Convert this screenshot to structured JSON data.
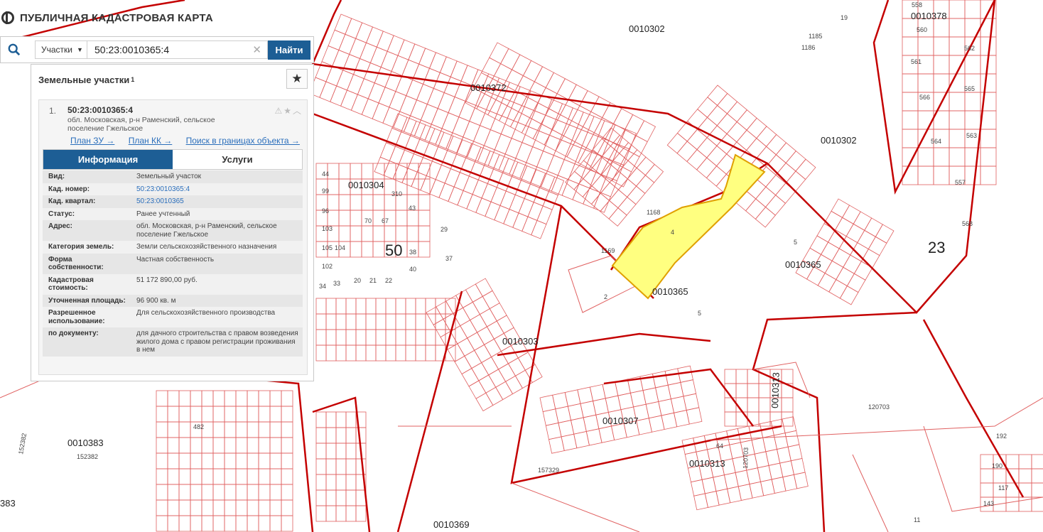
{
  "app": {
    "title": "ПУБЛИЧНАЯ КАДАСТРОВАЯ КАРТА"
  },
  "search": {
    "type_label": "Участки",
    "query": "50:23:0010365:4",
    "button_label": "Найти"
  },
  "panel": {
    "title": "Земельные участки",
    "count": "1",
    "result": {
      "index": "1.",
      "cadastral_number": "50:23:0010365:4",
      "address": "обл. Московская, р-н Раменский, сельское поселение Гжельское",
      "links": [
        "План ЗУ →",
        "План КК →",
        "Поиск в границах объекта →"
      ],
      "tabs": [
        "Информация",
        "Услуги"
      ],
      "attributes": [
        {
          "key": "Вид:",
          "value": "Земельный участок"
        },
        {
          "key": "Кад. номер:",
          "value": "50:23:0010365:4"
        },
        {
          "key": "Кад. квартал:",
          "value": "50:23:0010365"
        },
        {
          "key": "Статус:",
          "value": "Ранее учтенный"
        },
        {
          "key": "Адрес:",
          "value": "обл. Московская, р-н Раменский, сельское поселение Гжельское"
        },
        {
          "key": "Категория земель:",
          "value": "Земли сельскохозяйственного назначения"
        },
        {
          "key": "Форма собственности:",
          "value": "Частная собственность"
        },
        {
          "key": "Кадастровая стоимость:",
          "value": "51 172 890,00 руб."
        },
        {
          "key": "Уточненная площадь:",
          "value": "96 900 кв. м"
        },
        {
          "key": "Разрешенное использование:",
          "value": "Для сельскохозяйственного производства"
        },
        {
          "key": "по документу:",
          "value": "для дачного строительства с правом возведения жилого дома с правом регистрации проживания в нем"
        }
      ]
    }
  },
  "map": {
    "labels": {
      "q0010302a": "0010302",
      "q0010372": "0010372",
      "q0010302b": "0010302",
      "q0010304": "0010304",
      "q0010365a": "0010365",
      "q0010365b": "0010365",
      "q0010303": "0010303",
      "q0010307": "0010307",
      "q0010383": "0010383",
      "q152382": "152382",
      "q152382b": "152382",
      "q0010313a": "0010313",
      "q0010313b": "0010313",
      "q0010369": "0010369",
      "q120703": "120703",
      "q157329": "157329",
      "q0010378": "0010378",
      "num50": "50",
      "num23": "23",
      "num4": "4",
      "num2": "2",
      "num5a": "5",
      "num5b": "5",
      "n1168": "1168",
      "n1169": "1169",
      "n560": "560",
      "n561": "561",
      "n562": "562",
      "n565": "565",
      "n566": "566",
      "n563": "563",
      "n564": "564",
      "n557": "557",
      "n568": "568",
      "n558": "558",
      "n1185": "1185",
      "n1186": "1186",
      "n19": "19",
      "n192": "192",
      "n190": "190",
      "n383": "383",
      "n11": "11",
      "n120703b": "120703",
      "n64": "64",
      "n310": "310",
      "n44": "44",
      "n99": "99",
      "n96": "96",
      "n103": "103",
      "n105": "105",
      "n102": "102",
      "n104": "104",
      "n70": "70",
      "n67": "67",
      "n43": "43",
      "n38": "38",
      "n40": "40",
      "n37": "37",
      "n34": "34",
      "n33": "33",
      "n20": "20",
      "n21": "21",
      "n22": "22",
      "n29": "29",
      "n482": "482",
      "n143": "143",
      "n117": "117"
    },
    "colors": {
      "boundary": "#c40000",
      "thin": "#e06060",
      "highlight_fill": "#ffff80",
      "highlight_stroke": "#e0a000"
    }
  }
}
